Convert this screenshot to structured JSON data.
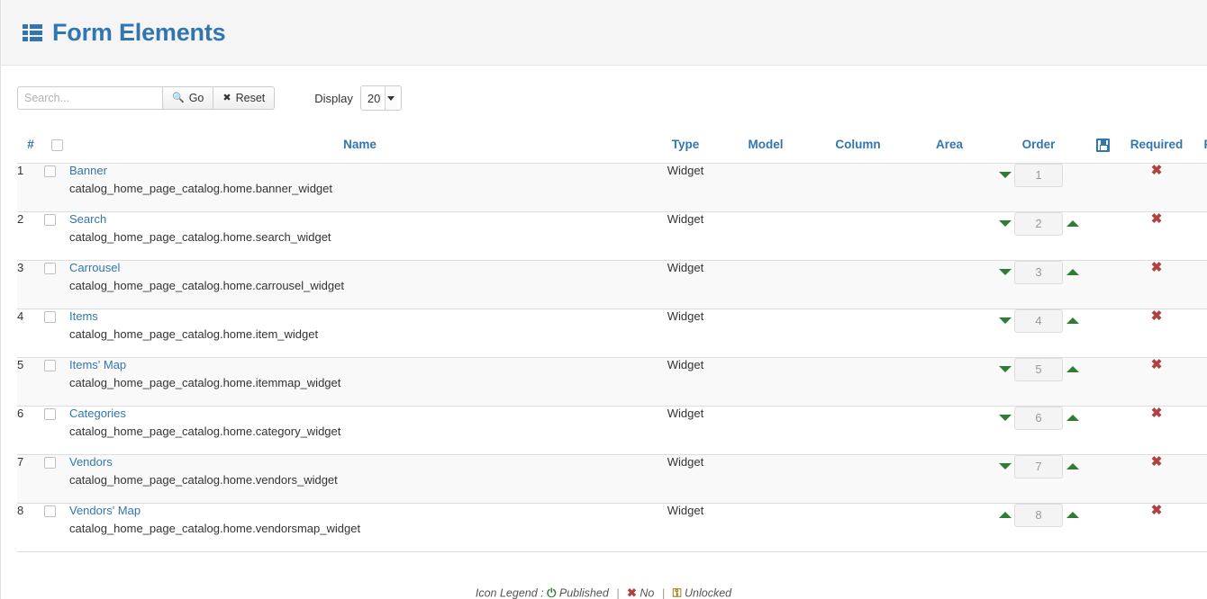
{
  "header": {
    "title": "Form Elements",
    "icon": "list-icon"
  },
  "toolbar": {
    "search_placeholder": "Search...",
    "search_value": "",
    "go_label": "Go",
    "go_icon": "search-icon",
    "reset_label": "Reset",
    "reset_icon": "close-icon",
    "display_label": "Display",
    "display_value": "20",
    "display_options": [
      "20"
    ]
  },
  "table": {
    "columns": {
      "num": "#",
      "name": "Name",
      "type": "Type",
      "model": "Model",
      "column": "Column",
      "area": "Area",
      "order": "Order",
      "save": "save-icon",
      "required": "Required",
      "published": "P"
    },
    "rows": [
      {
        "num": "1",
        "name": "Banner",
        "code": "catalog_home_page_catalog.home.banner_widget",
        "type": "Widget",
        "model": "",
        "column": "",
        "area": "",
        "order": "1",
        "has_down": true,
        "has_up": false,
        "required": "✖"
      },
      {
        "num": "2",
        "name": "Search",
        "code": "catalog_home_page_catalog.home.search_widget",
        "type": "Widget",
        "model": "",
        "column": "",
        "area": "",
        "order": "2",
        "has_down": true,
        "has_up": true,
        "required": "✖"
      },
      {
        "num": "3",
        "name": "Carrousel",
        "code": "catalog_home_page_catalog.home.carrousel_widget",
        "type": "Widget",
        "model": "",
        "column": "",
        "area": "",
        "order": "3",
        "has_down": true,
        "has_up": true,
        "required": "✖"
      },
      {
        "num": "4",
        "name": "Items",
        "code": "catalog_home_page_catalog.home.item_widget",
        "type": "Widget",
        "model": "",
        "column": "",
        "area": "",
        "order": "4",
        "has_down": true,
        "has_up": true,
        "required": "✖"
      },
      {
        "num": "5",
        "name": "Items' Map",
        "code": "catalog_home_page_catalog.home.itemmap_widget",
        "type": "Widget",
        "model": "",
        "column": "",
        "area": "",
        "order": "5",
        "has_down": true,
        "has_up": true,
        "required": "✖"
      },
      {
        "num": "6",
        "name": "Categories",
        "code": "catalog_home_page_catalog.home.category_widget",
        "type": "Widget",
        "model": "",
        "column": "",
        "area": "",
        "order": "6",
        "has_down": true,
        "has_up": true,
        "required": "✖"
      },
      {
        "num": "7",
        "name": "Vendors",
        "code": "catalog_home_page_catalog.home.vendors_widget",
        "type": "Widget",
        "model": "",
        "column": "",
        "area": "",
        "order": "7",
        "has_down": true,
        "has_up": true,
        "required": "✖"
      },
      {
        "num": "8",
        "name": "Vendors' Map",
        "code": "catalog_home_page_catalog.home.vendorsmap_widget",
        "type": "Widget",
        "model": "",
        "column": "",
        "area": "",
        "order": "8",
        "has_down": false,
        "has_up": true,
        "has_up_left": true,
        "required": "✖"
      }
    ]
  },
  "legend": {
    "label": "Icon Legend :",
    "published_icon": "⏻",
    "published_label": "Published",
    "no_icon": "✖",
    "no_label": "No",
    "unlocked_icon": "⚿",
    "unlocked_label": "Unlocked",
    "separator": "|"
  },
  "colors": {
    "accent": "#3276b1",
    "danger": "#b0413e",
    "success": "#2e7d32",
    "row_stripe": "#f9f9f9",
    "header_bg": "#f5f5f5"
  }
}
